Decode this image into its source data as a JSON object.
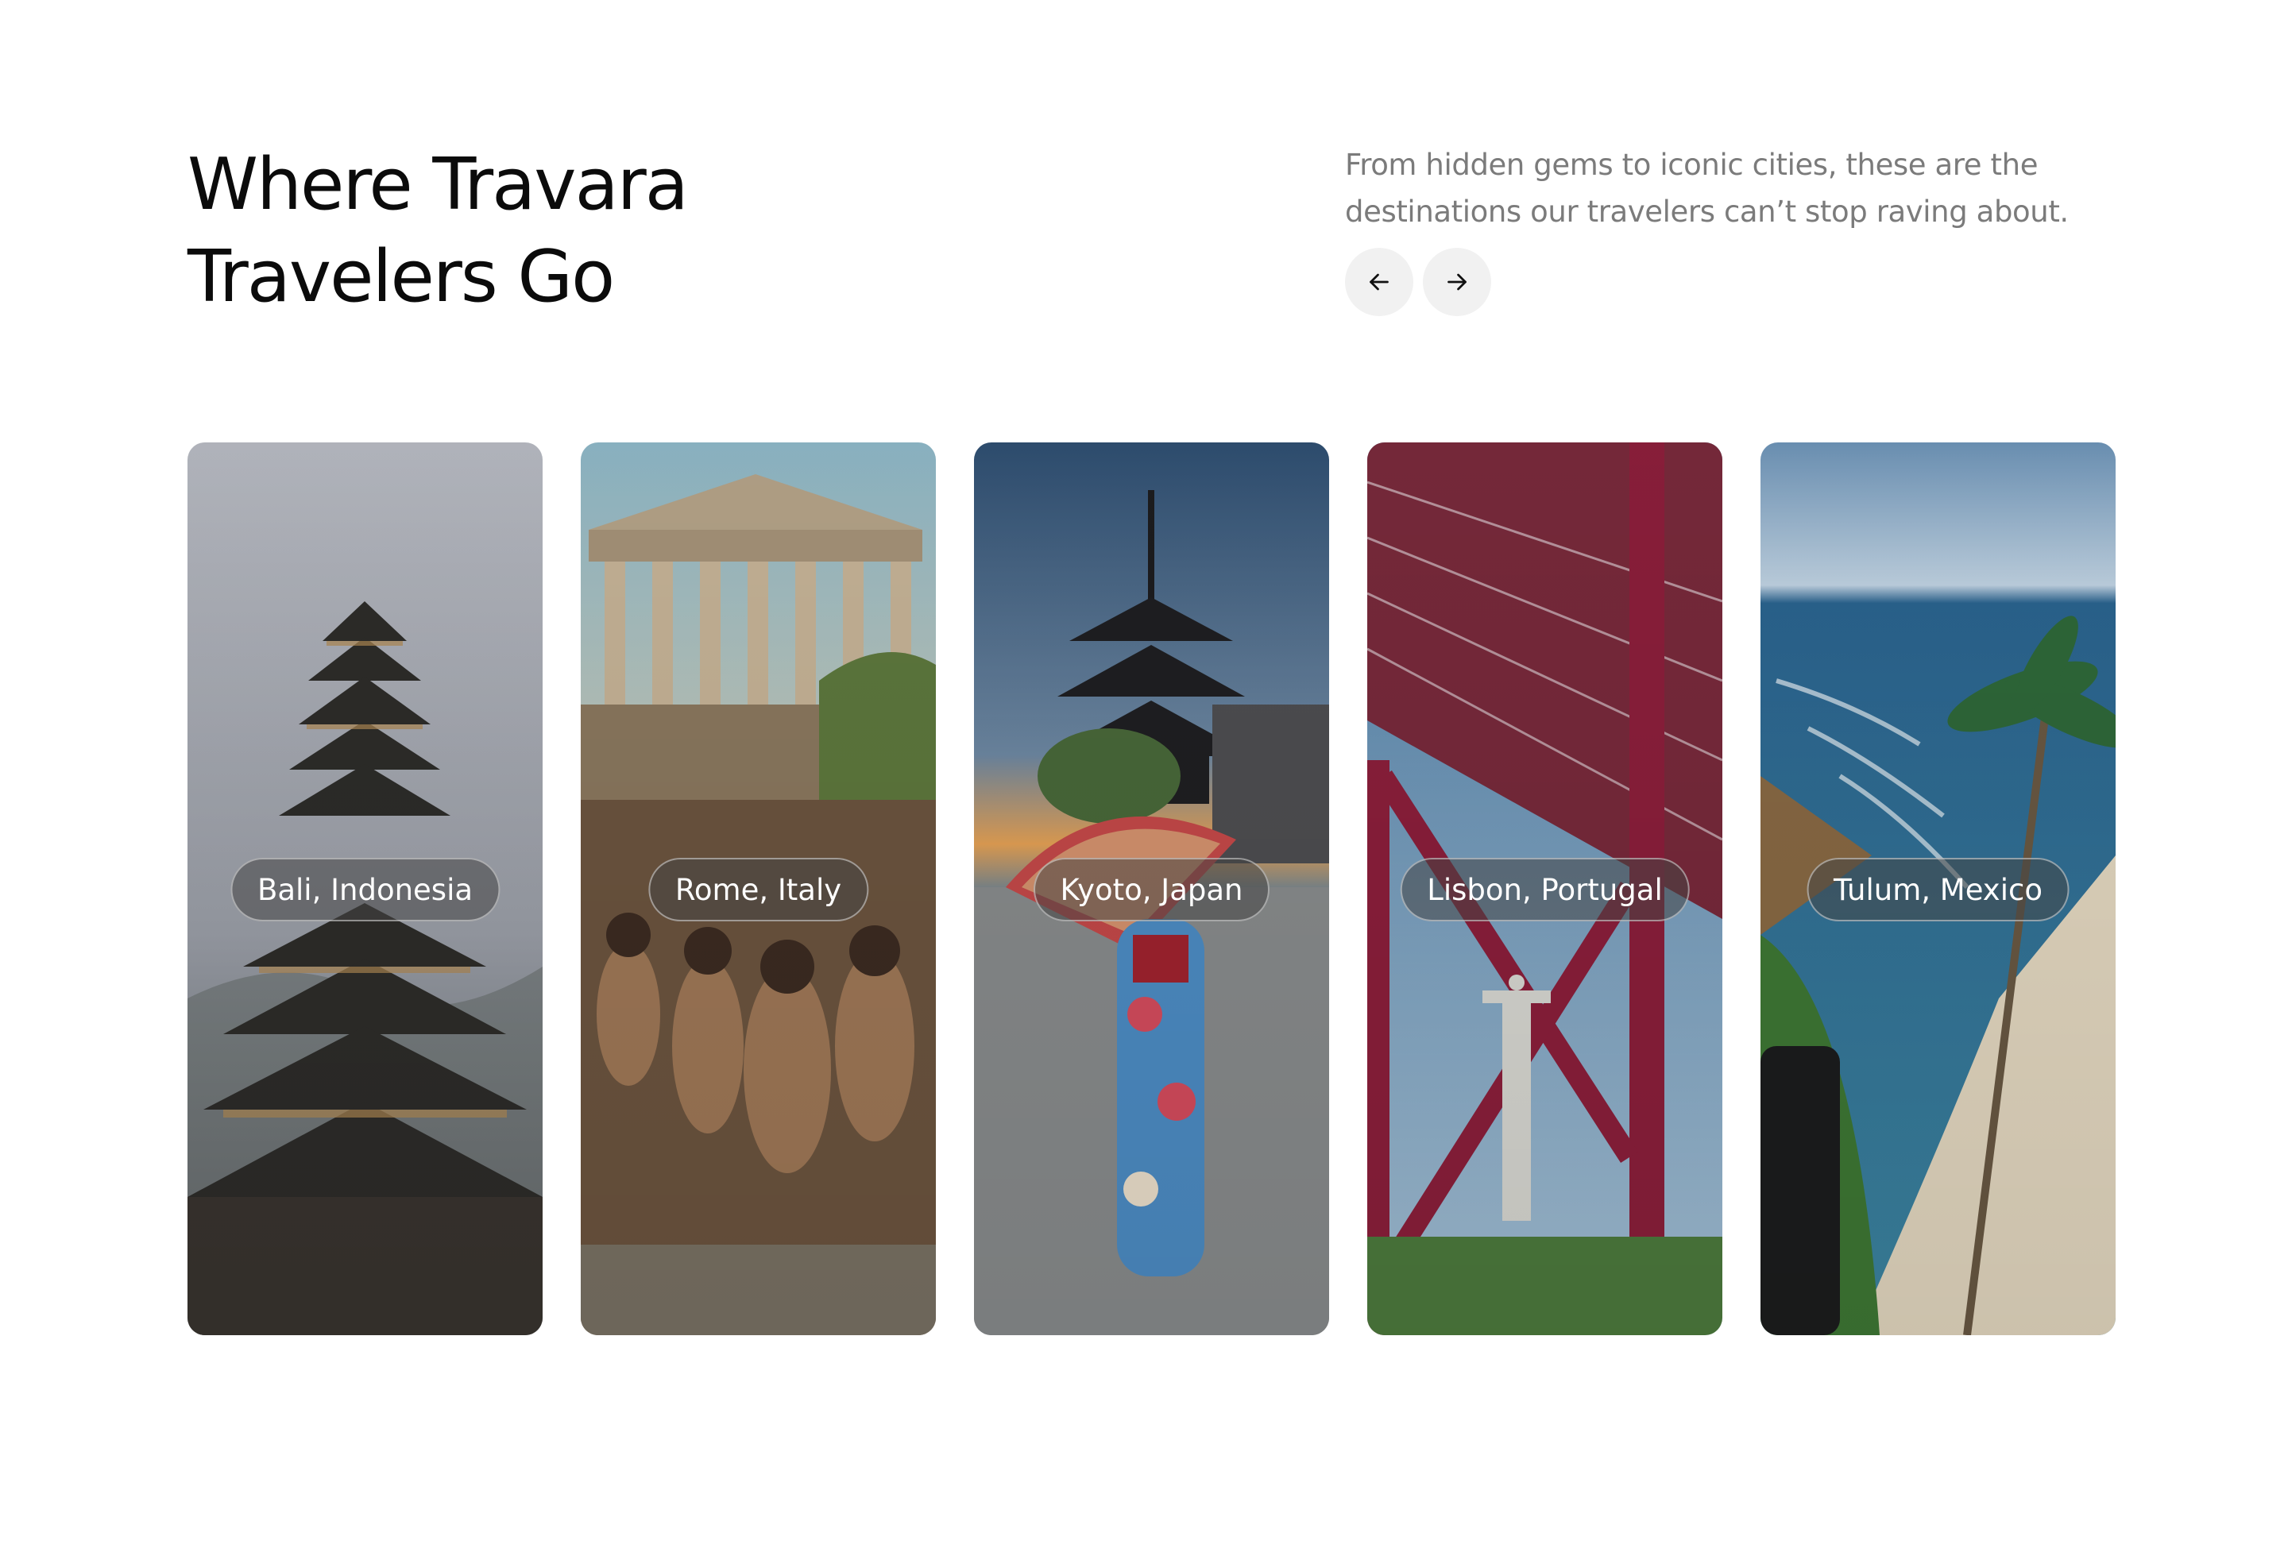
{
  "section": {
    "title_line1": "Where Travara",
    "title_line2": "Travelers Go",
    "description": "From hidden gems to iconic cities, these are the destinations our travelers can’t stop raving about."
  },
  "navigation": {
    "prev_icon": "arrow-left-icon",
    "next_icon": "arrow-right-icon"
  },
  "destinations": [
    {
      "label": "Bali, Indonesia",
      "image": "bali-temple-pagoda"
    },
    {
      "label": "Rome, Italy",
      "image": "rome-ancient-temple-crowd"
    },
    {
      "label": "Kyoto, Japan",
      "image": "kyoto-pagoda-kimono-umbrella"
    },
    {
      "label": "Lisbon, Portugal",
      "image": "lisbon-bridge-cristo-rei"
    },
    {
      "label": "Tulum, Mexico",
      "image": "tulum-beach-palm"
    }
  ],
  "colors": {
    "title": "#0b0b0b",
    "description": "#7b7b7b",
    "nav_button_bg": "#f1f1f1",
    "label_bg": "rgba(70,70,70,0.55)"
  }
}
